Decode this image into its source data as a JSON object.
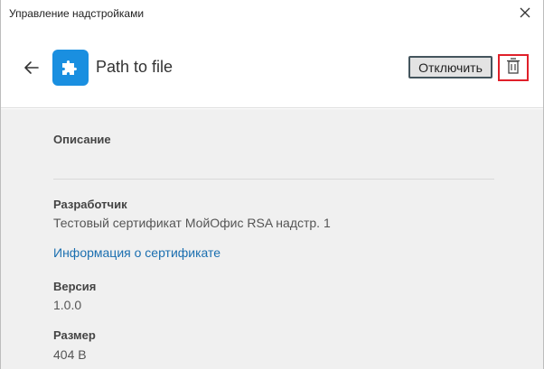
{
  "window": {
    "title": "Управление надстройками"
  },
  "addon": {
    "name": "Path to file",
    "icon": "puzzle-icon",
    "icon_color": "#1a8fe0",
    "disable_label": "Отключить"
  },
  "details": {
    "description_label": "Описание",
    "description_value": "",
    "developer_label": "Разработчик",
    "developer_value": "Тестовый сертификат МойОфис RSA надстр. 1",
    "certificate_link": "Информация о сертификате",
    "version_label": "Версия",
    "version_value": "1.0.0",
    "size_label": "Размер",
    "size_value": "404 B"
  },
  "colors": {
    "accent": "#1a8fe0",
    "link": "#1b6fb0",
    "delete_highlight": "#e0202a",
    "content_bg": "#f0f0f0"
  }
}
